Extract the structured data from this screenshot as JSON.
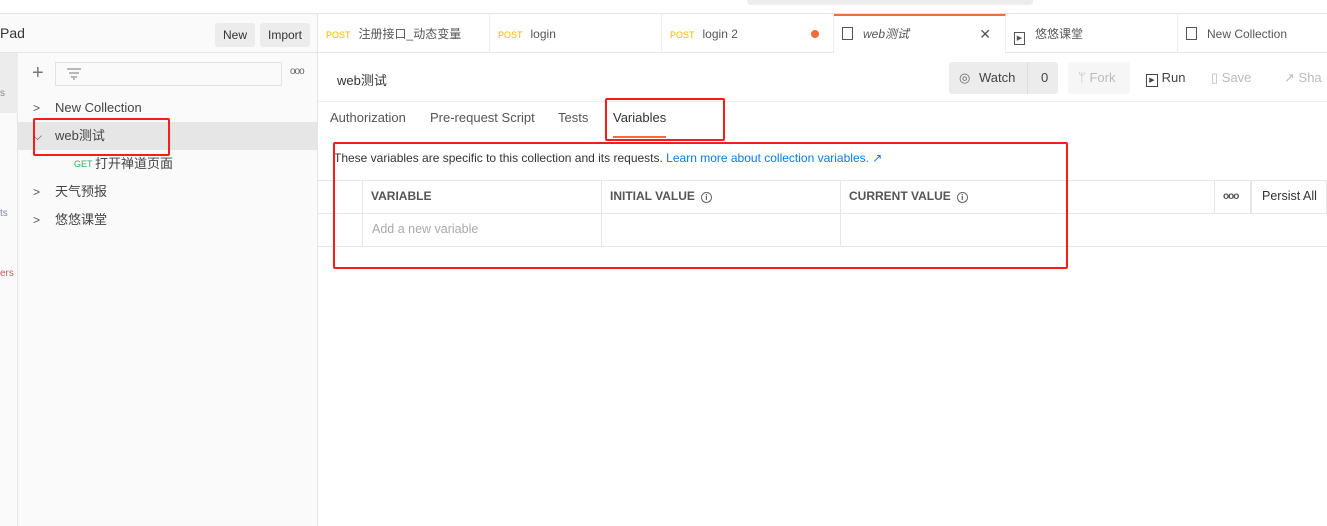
{
  "workspace": {
    "title_fragment": "Pad",
    "new_label": "New",
    "import_label": "Import"
  },
  "rail": {
    "items": [
      "s",
      "ts",
      "ers"
    ]
  },
  "sidebar": {
    "collections": [
      {
        "label": "New Collection",
        "expanded": false
      },
      {
        "label": "web测试",
        "expanded": true,
        "requests": [
          {
            "method": "GET",
            "label": "打开禅道页面"
          }
        ]
      },
      {
        "label": "天气预报",
        "expanded": false
      },
      {
        "label": "悠悠课堂",
        "expanded": false
      }
    ]
  },
  "tabs": [
    {
      "method": "POST",
      "label": "注册接口_动态变量"
    },
    {
      "method": "POST",
      "label": "login"
    },
    {
      "method": "POST",
      "label": "login 2",
      "unsaved": true
    },
    {
      "label": "web测试",
      "active": true
    },
    {
      "label": "悠悠课堂"
    },
    {
      "label": "New Collection"
    }
  ],
  "collection": {
    "title": "web测试",
    "watch_label": "Watch",
    "watch_count": "0",
    "fork_label": "Fork",
    "run_label": "Run",
    "save_label": "Save",
    "share_label": "Sha"
  },
  "subtabs": [
    "Authorization",
    "Pre-request Script",
    "Tests",
    "Variables"
  ],
  "variables": {
    "description": "These variables are specific to this collection and its requests.",
    "learn_more": "Learn more about collection variables. ↗",
    "headers": [
      "VARIABLE",
      "INITIAL VALUE",
      "CURRENT VALUE"
    ],
    "persist_all": "Persist All",
    "placeholder": "Add a new variable"
  },
  "colors": {
    "accent": "#f26b3a",
    "post": "#f5b700",
    "get": "#2fb35f",
    "link": "#097bed",
    "highlight": "#ff1a1a"
  }
}
